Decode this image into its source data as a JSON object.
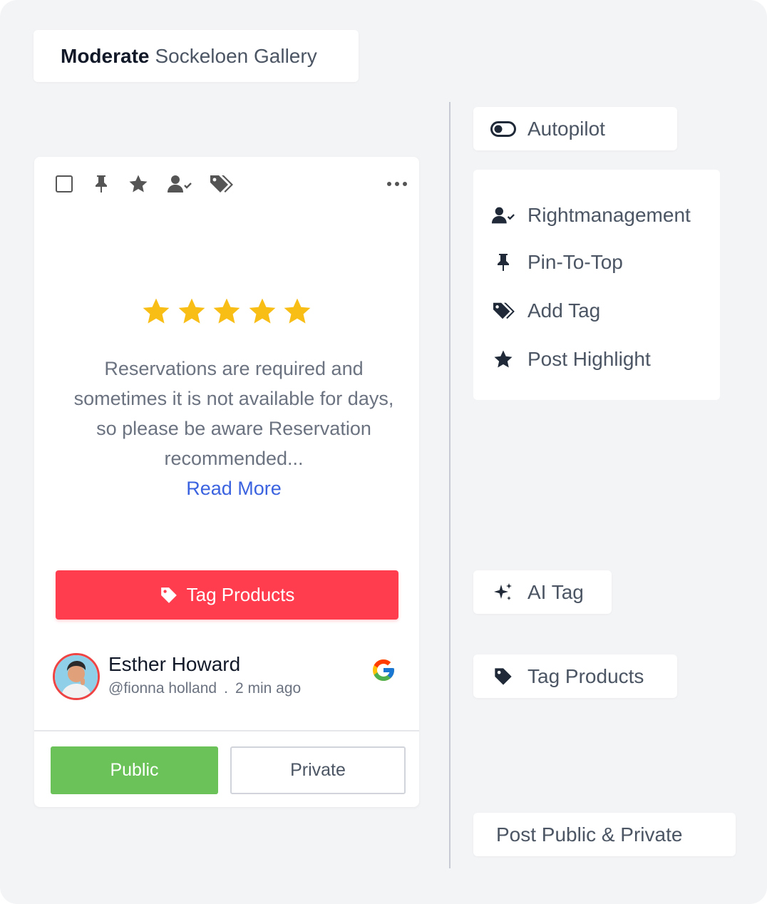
{
  "header": {
    "title_bold": "Moderate",
    "title_rest": "Sockeloen Gallery"
  },
  "card": {
    "toolbar_icons": [
      "checkbox",
      "pin-icon",
      "star-icon",
      "user-check-icon",
      "tags-icon",
      "more-icon"
    ],
    "rating": 5,
    "review_text": "Reservations are required and sometimes it is not available for days, so please be aware Reservation recommended...",
    "read_more": "Read More",
    "tag_button": "Tag Products",
    "author": {
      "name": "Esther Howard",
      "handle": "@fionna holland",
      "separator": ".",
      "time": "2 min ago"
    },
    "public_label": "Public",
    "private_label": "Private"
  },
  "features": {
    "autopilot": "Autopilot",
    "menu": [
      {
        "label": "Rightmanagement",
        "icon": "user-check-icon"
      },
      {
        "label": "Pin-To-Top",
        "icon": "pin-icon"
      },
      {
        "label": "Add Tag",
        "icon": "tags-icon"
      },
      {
        "label": "Post Highlight",
        "icon": "star-icon"
      }
    ],
    "ai_tag": "AI Tag",
    "tag_products": "Tag Products",
    "post_public_private": "Post Public & Private"
  },
  "colors": {
    "accent_red": "#ff3d4f",
    "green": "#6ac259",
    "link_blue": "#3b63e0",
    "star_gold": "#f9be16"
  }
}
